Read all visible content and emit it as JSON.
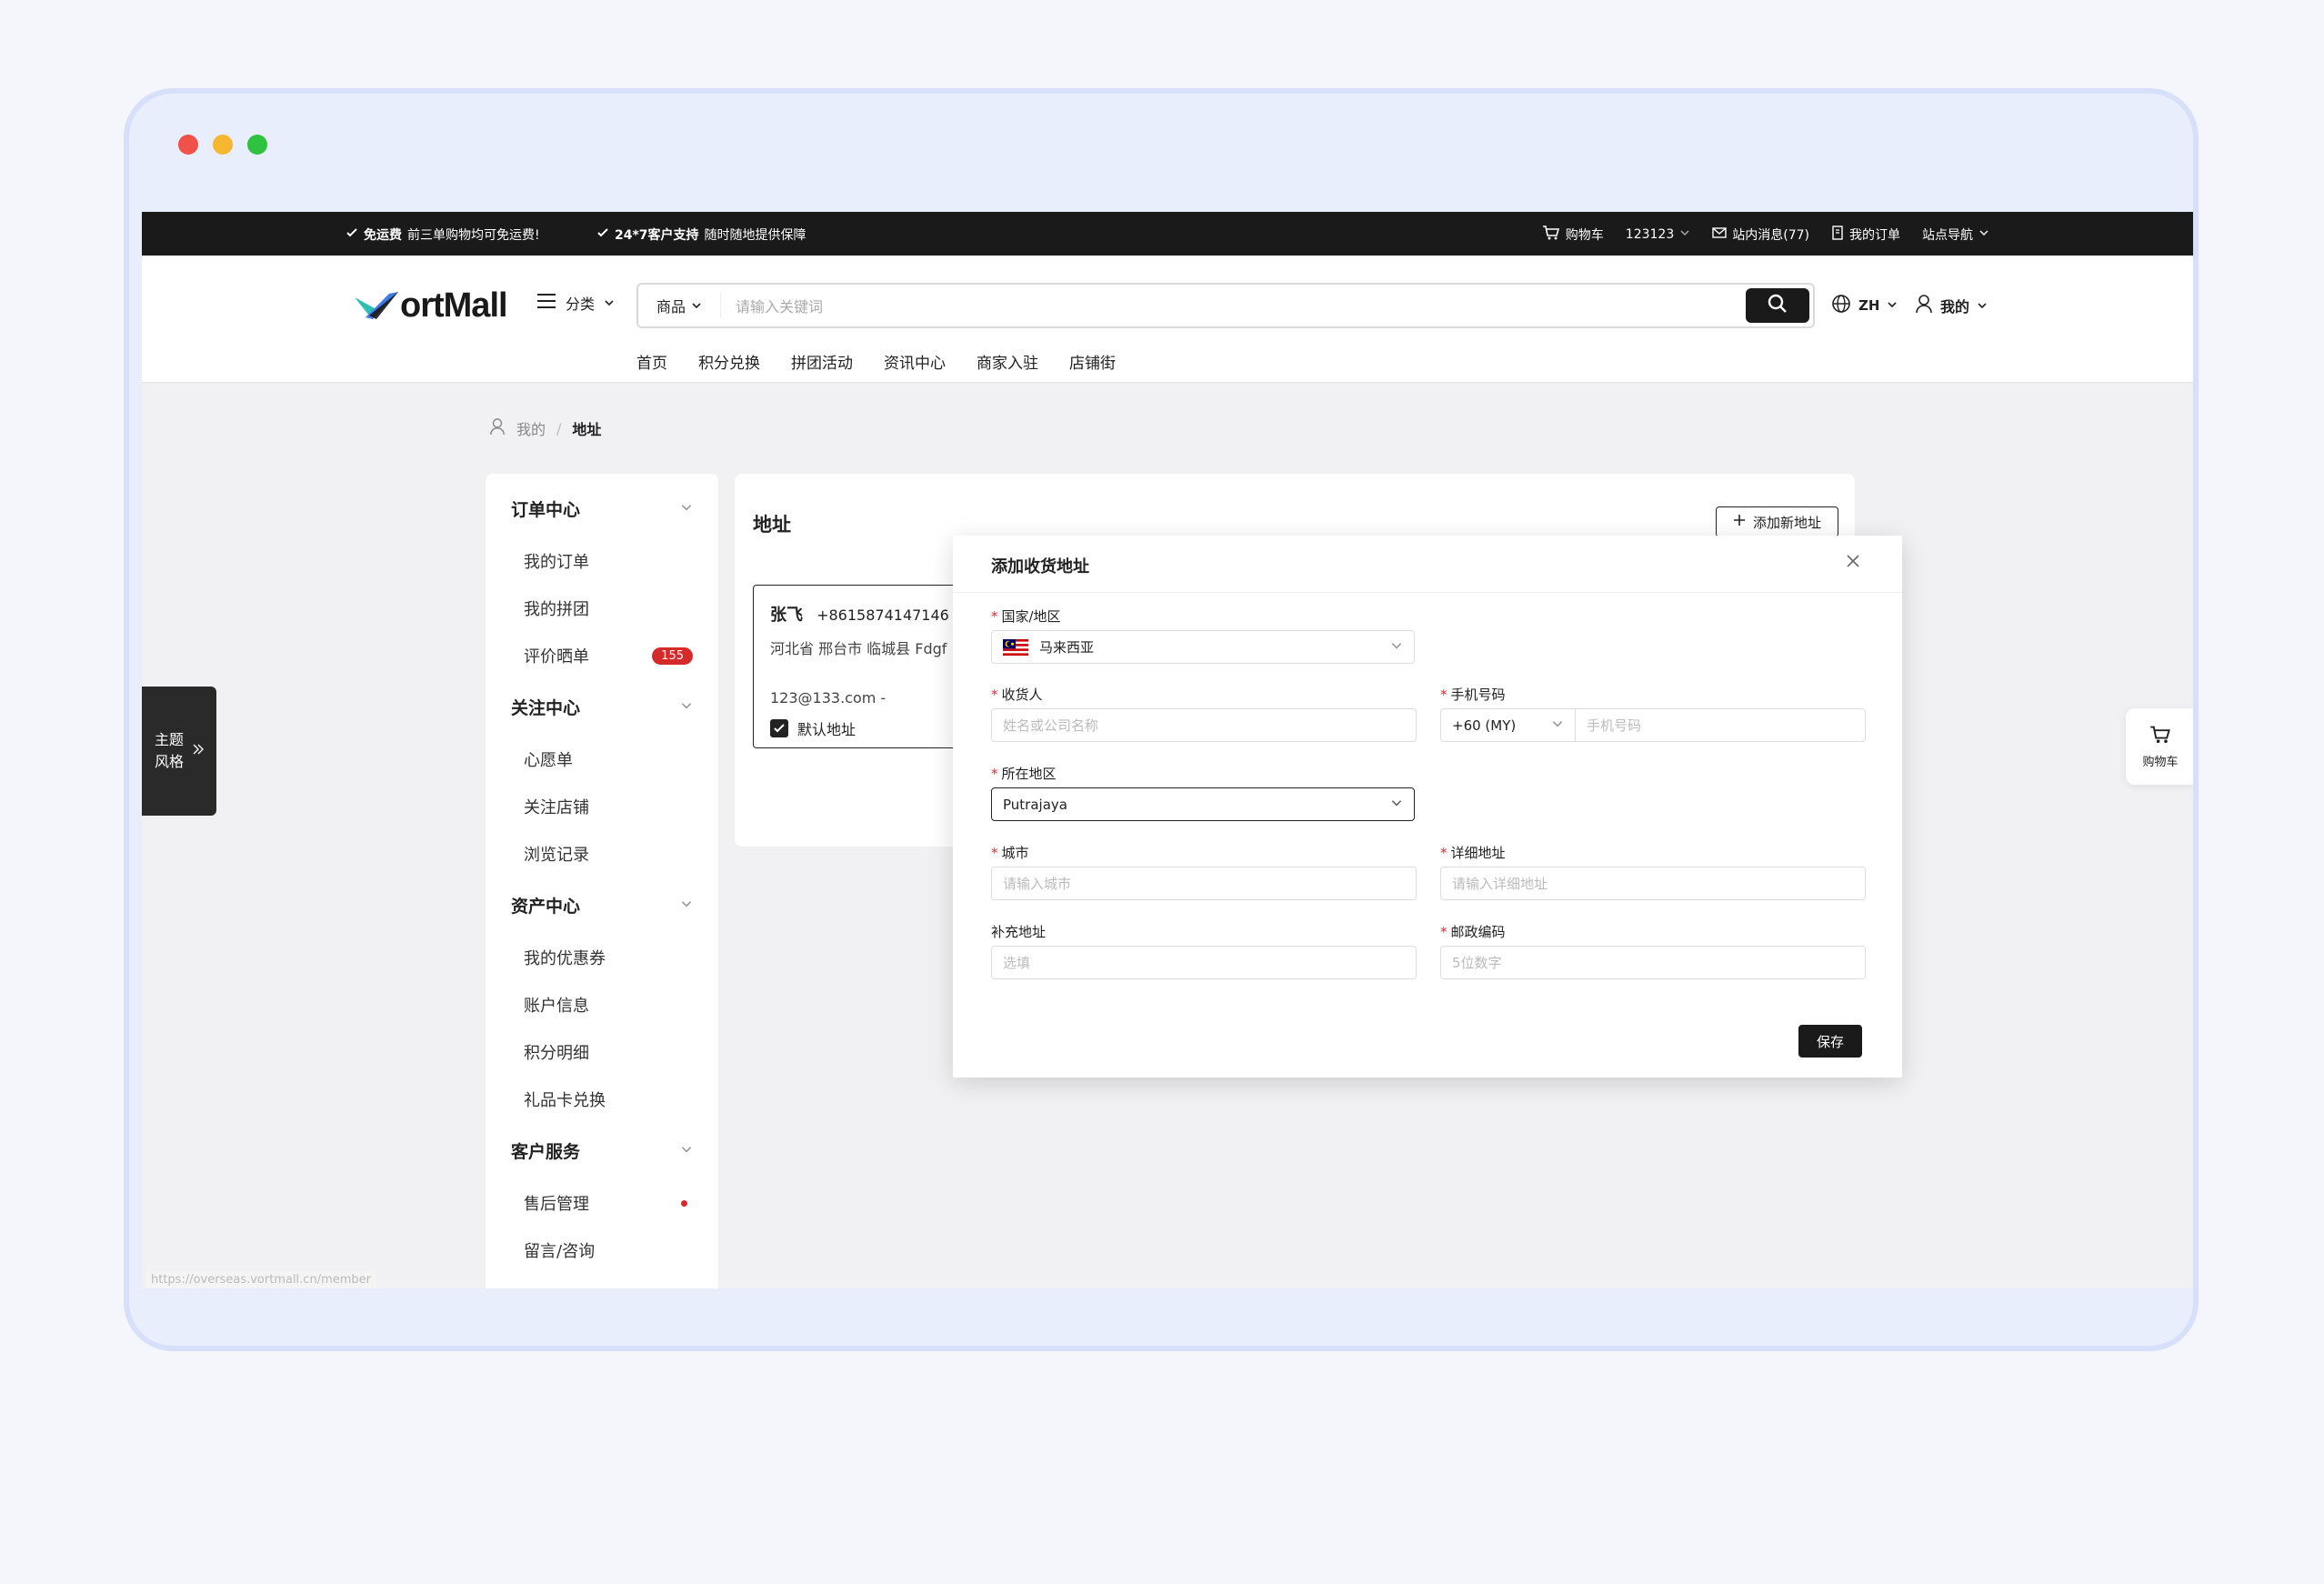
{
  "colors": {
    "accent_dark": "#1a1a1a",
    "badge_red": "#d42a2a",
    "logo_blue": "#3d7be8",
    "logo_teal": "#2bbfb3"
  },
  "topbar": {
    "promo1_title": "免运费",
    "promo1_text": "前三单购物均可免运费!",
    "promo2_title": "24*7客户支持",
    "promo2_text": "随时随地提供保障",
    "cart": "购物车",
    "user": "123123",
    "messages": "站内消息(77)",
    "orders": "我的订单",
    "sitenav": "站点导航"
  },
  "header": {
    "logo_text": "ortMall",
    "category": "分类",
    "search_type": "商品",
    "search_placeholder": "请输入关键词",
    "lang": "ZH",
    "me": "我的",
    "nav": [
      "首页",
      "积分兑换",
      "拼团活动",
      "资讯中心",
      "商家入驻",
      "店铺街"
    ]
  },
  "breadcrumb": {
    "root": "我的",
    "sep": "/",
    "current": "地址"
  },
  "sidebar": {
    "groups": [
      {
        "title": "订单中心",
        "items": [
          {
            "label": "我的订单"
          },
          {
            "label": "我的拼团"
          },
          {
            "label": "评价晒单",
            "badge": "155"
          }
        ]
      },
      {
        "title": "关注中心",
        "items": [
          {
            "label": "心愿单"
          },
          {
            "label": "关注店铺"
          },
          {
            "label": "浏览记录"
          }
        ]
      },
      {
        "title": "资产中心",
        "items": [
          {
            "label": "我的优惠券"
          },
          {
            "label": "账户信息"
          },
          {
            "label": "积分明细"
          },
          {
            "label": "礼品卡兑换"
          }
        ]
      },
      {
        "title": "客户服务",
        "items": [
          {
            "label": "售后管理",
            "dot": true
          },
          {
            "label": "留言/咨询"
          }
        ]
      }
    ]
  },
  "content": {
    "title": "地址",
    "add_button": "添加新地址",
    "card": {
      "name": "张飞",
      "phone": "+8615874147146",
      "address": "河北省 邢台市 临城县 Fdgf",
      "email": "123@133.com  -",
      "default_label": "默认地址"
    }
  },
  "theme_tab": {
    "line1": "主题",
    "line2": "风格"
  },
  "cart_float": {
    "label": "购物车"
  },
  "status_url": "https://overseas.vortmall.cn/member",
  "modal": {
    "title": "添加收货地址",
    "country_label": "国家/地区",
    "country_value": "马来西亚",
    "receiver_label": "收货人",
    "receiver_placeholder": "姓名或公司名称",
    "phone_label": "手机号码",
    "phone_code": "+60 (MY)",
    "phone_placeholder": "手机号码",
    "region_label": "所在地区",
    "region_value": "Putrajaya",
    "city_label": "城市",
    "city_placeholder": "请输入城市",
    "detail_label": "详细地址",
    "detail_placeholder": "请输入详细地址",
    "extra_label": "补充地址",
    "extra_placeholder": "选填",
    "zip_label": "邮政编码",
    "zip_placeholder": "5位数字",
    "save": "保存"
  }
}
